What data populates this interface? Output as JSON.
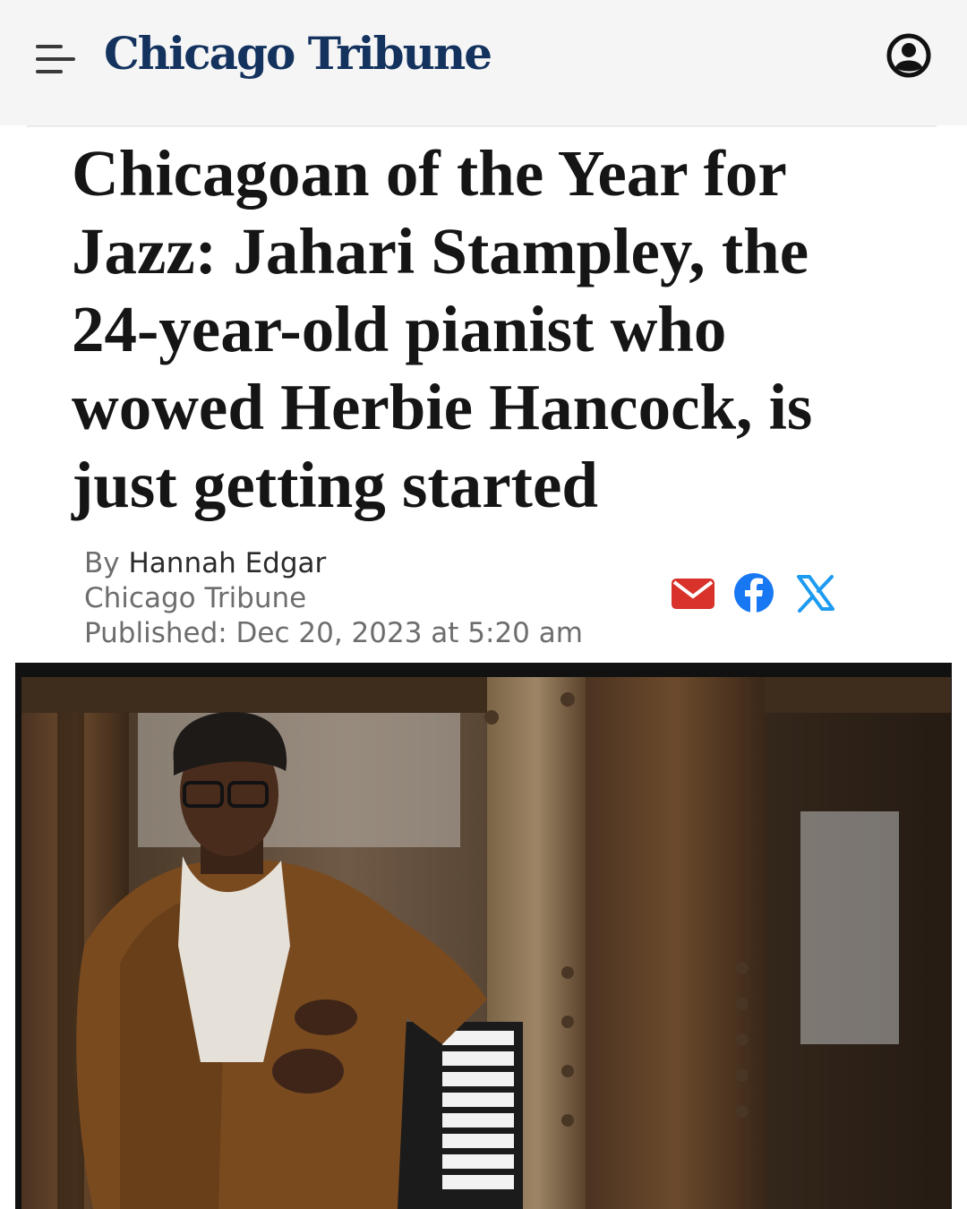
{
  "header": {
    "brand": "Chicago Tribune",
    "menu_icon": "hamburger-menu-icon",
    "account_icon": "account-circle-icon",
    "brand_color": "#13325e"
  },
  "article": {
    "headline": "Chicagoan of the Year for Jazz: Jahari Stampley, the 24-year-old pianist who wowed Herbie Hancock, is just getting started",
    "byline_prefix": "By",
    "author": "Hannah Edgar",
    "publication": "Chicago Tribune",
    "published": "Published: Dec 20, 2023 at 5:20 am",
    "share": [
      {
        "icon": "mail-icon",
        "color": "#d8322a"
      },
      {
        "icon": "facebook-icon",
        "color": "#1877f2"
      },
      {
        "icon": "x-icon",
        "color": "#1d9bf0"
      }
    ]
  },
  "photo": {
    "subject": "portrait-photo",
    "colors": {
      "rust": "#6b4a2c",
      "coat": "#7a4a1f",
      "steel": "#8a7a62"
    }
  }
}
